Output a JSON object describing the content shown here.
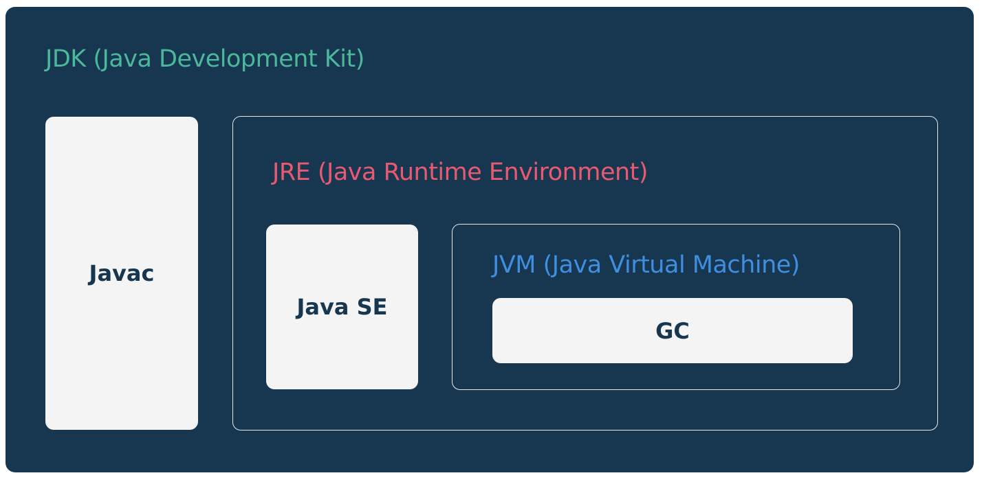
{
  "jdk": {
    "title": "JDK (Java Development Kit)",
    "title_color": "#4cb89b",
    "background": "#17364f"
  },
  "javac": {
    "label": "Javac"
  },
  "jre": {
    "title": "JRE (Java Runtime Environment)",
    "title_color": "#e85a72"
  },
  "java_se": {
    "label": "Java SE"
  },
  "jvm": {
    "title": "JVM (Java Virtual Machine)",
    "title_color": "#3f8ee0"
  },
  "gc": {
    "label": "GC"
  },
  "colors": {
    "block_fill": "#f4f4f4",
    "block_text": "#17364f",
    "outline": "#e6eaef"
  }
}
